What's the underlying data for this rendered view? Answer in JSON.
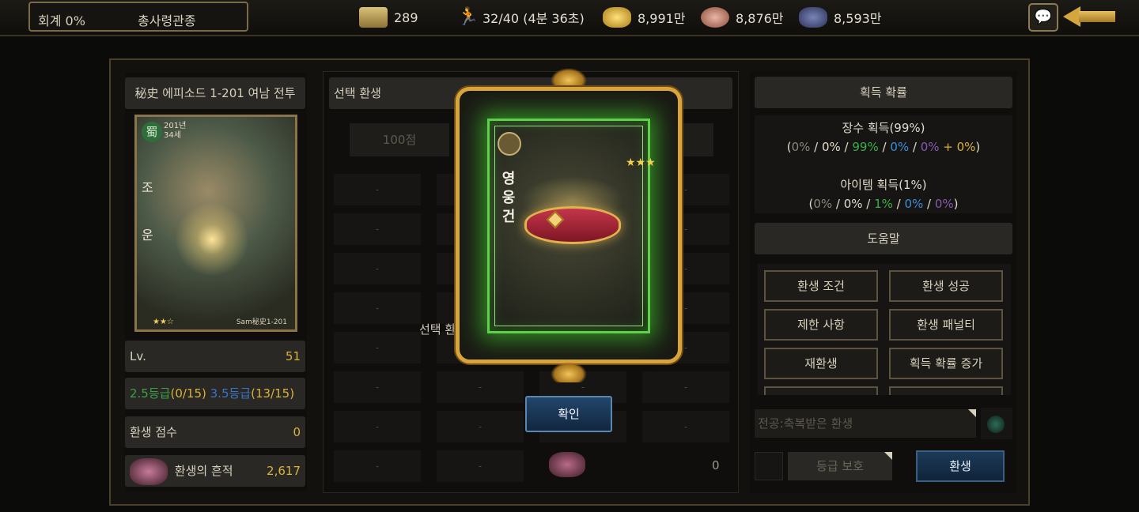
{
  "topbar": {
    "account": "회계 0%",
    "title": "총사령관종",
    "resources": [
      {
        "icon": "scroll-icon",
        "value": "289"
      },
      {
        "icon": "runner-icon",
        "value": "32/40 (4분 36초)"
      },
      {
        "icon": "gold-icon",
        "value": "8,991만"
      },
      {
        "icon": "food-icon",
        "value": "8,876만"
      },
      {
        "icon": "ore-icon",
        "value": "8,593만"
      }
    ]
  },
  "left": {
    "episode": "秘史 에피소드 1-201 여남 전투",
    "card": {
      "faction": "蜀",
      "year": "201년",
      "age": "34세",
      "name": "조운",
      "stars": "★★☆",
      "tag": "Sam秘史1-201"
    },
    "lv_label": "Lv.",
    "lv_value": "51",
    "grade_a": "2.5등급",
    "grade_a_count": "(0/15)",
    "grade_b": "3.5등급",
    "grade_b_count": "(13/15)",
    "score_label": "환생 점수",
    "score_value": "0",
    "trace_label": "환생의 흔적",
    "trace_value": "2,617"
  },
  "middle": {
    "header": "선택 환생",
    "score_button": "100점",
    "cell_text": "-",
    "select_label": "선택 환",
    "zero": "0"
  },
  "right": {
    "prob_header": "획득 확률",
    "general_title": "장수 획득(99%)",
    "general_parts": [
      "(",
      "0%",
      " / ",
      "0%",
      " / ",
      "99%",
      " / ",
      "0%",
      " / ",
      "0%",
      " + ",
      "0%",
      ")"
    ],
    "item_title": "아이템 획득(1%)",
    "item_parts": [
      "(",
      "0%",
      " / ",
      "0%",
      " / ",
      "1%",
      " / ",
      "0%",
      " / ",
      "0%",
      ")"
    ],
    "help_header": "도움말",
    "help_buttons": [
      "환생 조건",
      "환생 성공",
      "제한 사항",
      "환생 패널티",
      "재환생",
      "획득 확률 증가"
    ],
    "passive_placeholder": "전공:축복받은 환생",
    "grade_protect": "등급 보호",
    "rebirth_button": "환생"
  },
  "popup": {
    "item_name": "영웅건",
    "stars": "★★★",
    "confirm": "확인"
  }
}
